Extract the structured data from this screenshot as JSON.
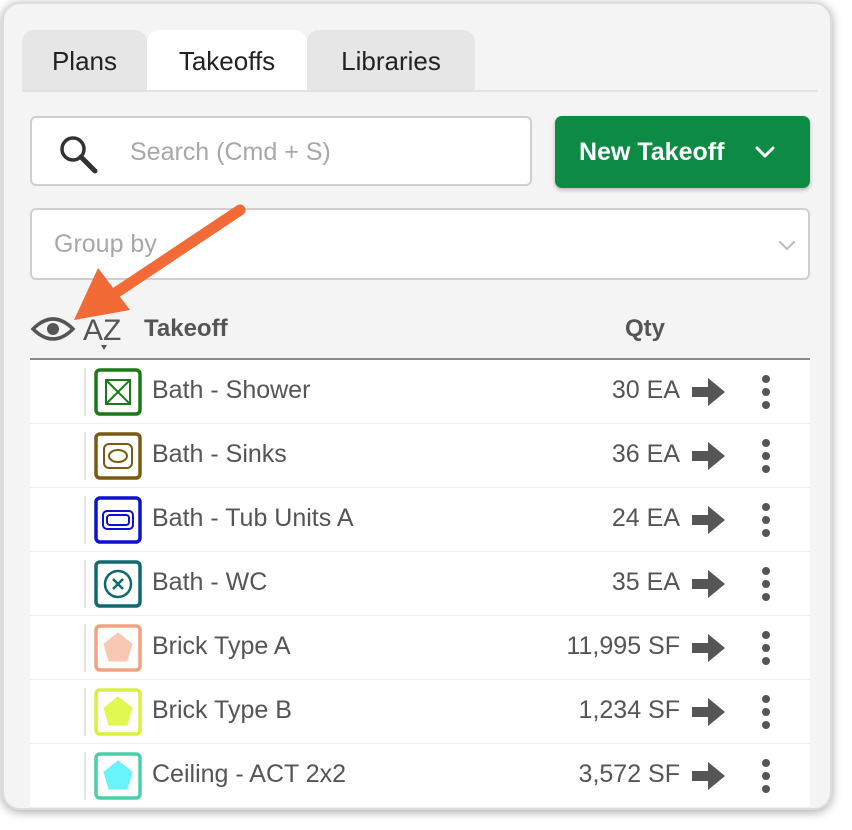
{
  "tabs": [
    {
      "label": "Plans",
      "active": false
    },
    {
      "label": "Takeoffs",
      "active": true
    },
    {
      "label": "Libraries",
      "active": false
    }
  ],
  "search": {
    "placeholder": "Search (Cmd + S)",
    "icon": "search-icon"
  },
  "new_takeoff": {
    "label": "New Takeoff",
    "color": "#0d8a44",
    "icon": "chevron-down-icon"
  },
  "group_by": {
    "placeholder": "Group by"
  },
  "header": {
    "takeoff": "Takeoff",
    "qty": "Qty",
    "sort_icon": "sort-az-icon",
    "visibility_icon": "eye-icon"
  },
  "annotation": {
    "color": "#f26a35",
    "icon": "arrow-icon"
  },
  "rows": [
    {
      "name": "Bath - Shower",
      "qty": "30 EA",
      "icon": "shower-icon",
      "color": "#1a7a1a"
    },
    {
      "name": "Bath - Sinks",
      "qty": "36 EA",
      "icon": "sink-icon",
      "color": "#7a5a10"
    },
    {
      "name": "Bath - Tub Units A",
      "qty": "24 EA",
      "icon": "tub-icon",
      "color": "#1010d0"
    },
    {
      "name": "Bath - WC",
      "qty": "35 EA",
      "icon": "wc-icon",
      "color": "#0f6a70"
    },
    {
      "name": "Brick Type A",
      "qty": "11,995 SF",
      "icon": "pentagon-icon",
      "color": "#f2a080"
    },
    {
      "name": "Brick Type B",
      "qty": "1,234 SF",
      "icon": "pentagon-icon",
      "color": "#d8f040"
    },
    {
      "name": "Ceiling - ACT 2x2",
      "qty": "3,572 SF",
      "icon": "pentagon-icon",
      "color": "#60f0f8"
    }
  ]
}
